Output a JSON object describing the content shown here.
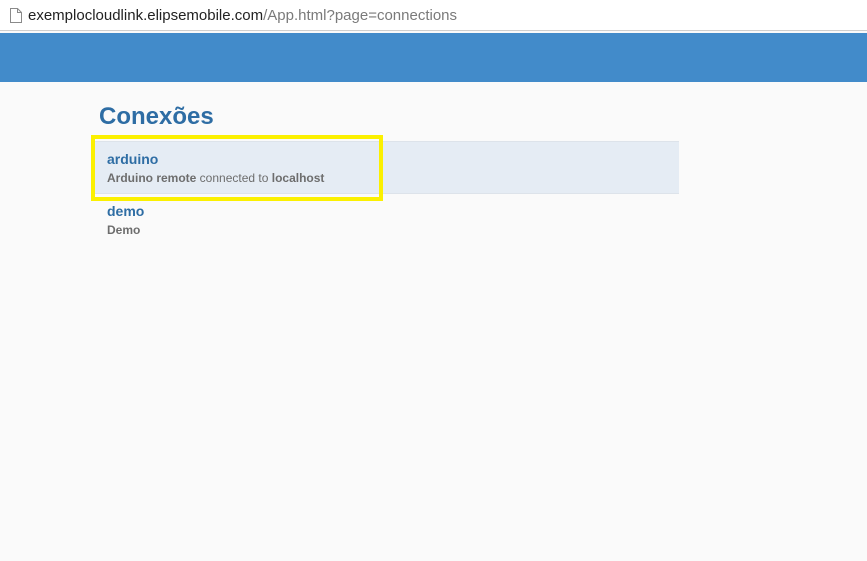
{
  "browser": {
    "url_host": "exemplocloudlink.elipsemobile.com",
    "url_path": "/App.html?page=connections",
    "page_icon": "page-icon"
  },
  "page": {
    "title": "Conexões"
  },
  "connections": [
    {
      "name": "arduino",
      "desc_bold": "Arduino remote",
      "desc_mid": " connected to ",
      "desc_end": "localhost",
      "selected": true
    },
    {
      "name": "demo",
      "desc_bold": "Demo",
      "desc_mid": "",
      "desc_end": "",
      "selected": false
    }
  ],
  "colors": {
    "header": "#428bca",
    "title": "#2e6da4",
    "selected_row": "#e5ecf4",
    "highlight": "#fbf000"
  }
}
